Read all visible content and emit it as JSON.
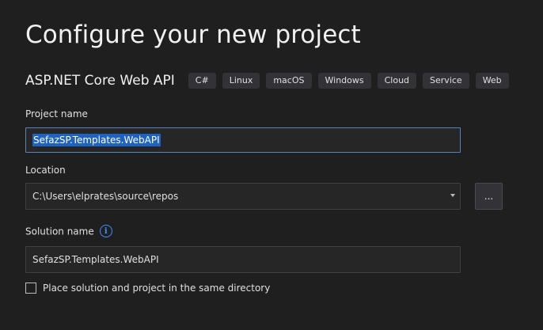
{
  "header": {
    "title": "Configure your new project"
  },
  "template": {
    "name": "ASP.NET Core Web API",
    "tags": [
      "C#",
      "Linux",
      "macOS",
      "Windows",
      "Cloud",
      "Service",
      "Web"
    ]
  },
  "form": {
    "project_name": {
      "label": "Project name",
      "value": "SefazSP.Templates.WebAPI"
    },
    "location": {
      "label": "Location",
      "value": "C:\\Users\\elprates\\source\\repos",
      "browse_label": "..."
    },
    "solution_name": {
      "label": "Solution name",
      "info_icon": "info-icon",
      "value": "SefazSP.Templates.WebAPI"
    },
    "same_directory": {
      "label": "Place solution and project in the same directory",
      "checked": false
    }
  }
}
